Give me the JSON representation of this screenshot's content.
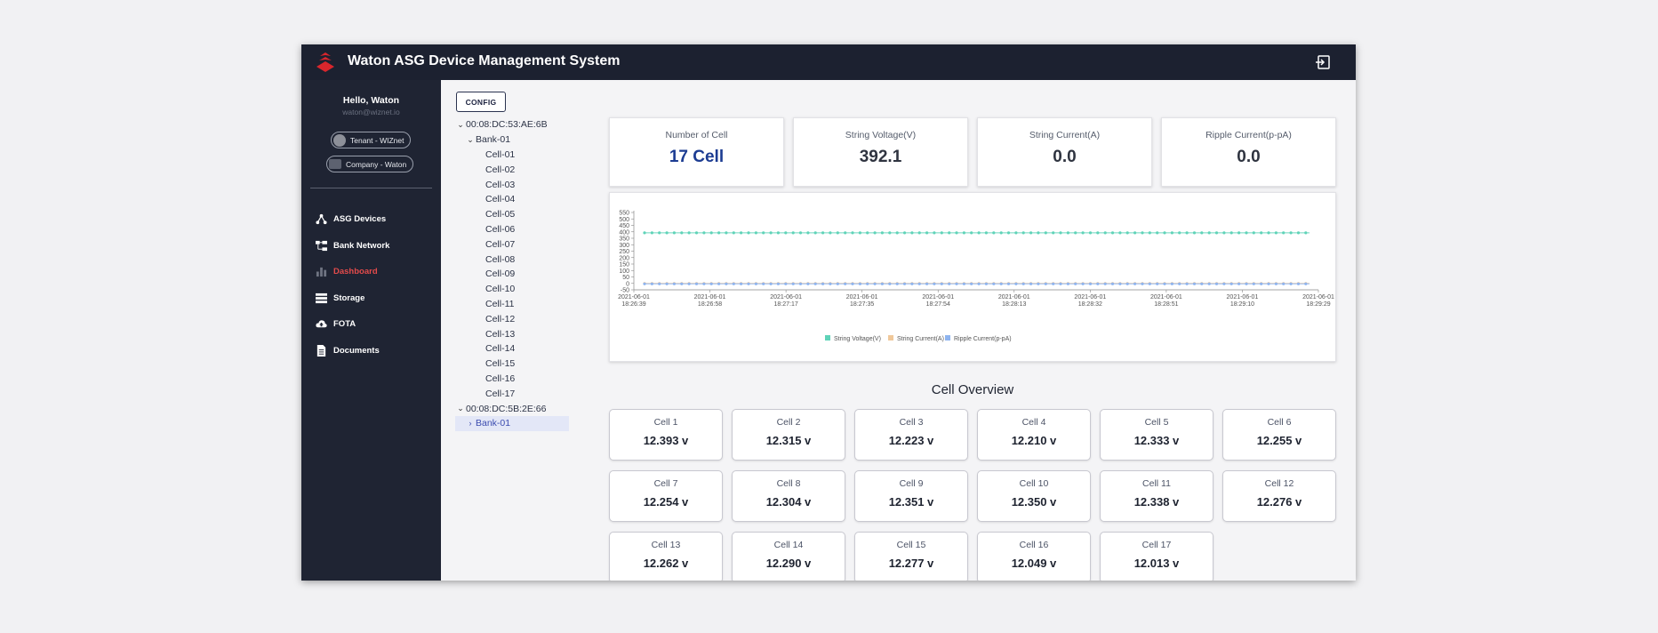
{
  "app": {
    "title": "Waton ASG Device Management System"
  },
  "colors": {
    "topbar": "#1c2130",
    "sidebar": "#1f2433",
    "active": "#e34b4b",
    "accent_blue": "#1c3c92",
    "voltage": "#5fd3b8",
    "current": "#f0c89a",
    "ripple": "#8eb4ef"
  },
  "user": {
    "hello": "Hello, Waton",
    "email": "waton@wiznet.io",
    "tenant": "Tenant - WIZnet",
    "company": "Company - Waton"
  },
  "menu": [
    {
      "label": "ASG Devices",
      "icon": "network-icon"
    },
    {
      "label": "Bank Network",
      "icon": "hierarchy-icon"
    },
    {
      "label": "Dashboard",
      "icon": "bar-chart-icon",
      "active": true
    },
    {
      "label": "Storage",
      "icon": "list-icon"
    },
    {
      "label": "FOTA",
      "icon": "cloud-upload-icon"
    },
    {
      "label": "Documents",
      "icon": "document-icon"
    }
  ],
  "config_label": "CONFIG",
  "tree": {
    "device1": "00:08:DC:53:AE:6B",
    "bank1": "Bank-01",
    "cells": [
      "Cell-01",
      "Cell-02",
      "Cell-03",
      "Cell-04",
      "Cell-05",
      "Cell-06",
      "Cell-07",
      "Cell-08",
      "Cell-09",
      "Cell-10",
      "Cell-11",
      "Cell-12",
      "Cell-13",
      "Cell-14",
      "Cell-15",
      "Cell-16",
      "Cell-17"
    ],
    "device2": "00:08:DC:5B:2E:66",
    "bank2": "Bank-01"
  },
  "stats": [
    {
      "label": "Number of Cell",
      "value": "17 Cell"
    },
    {
      "label": "String Voltage(V)",
      "value": "392.1"
    },
    {
      "label": "String Current(A)",
      "value": "0.0"
    },
    {
      "label": "Ripple Current(p-pA)",
      "value": "0.0"
    }
  ],
  "chart_data": {
    "type": "line",
    "x_ticks": [
      [
        "2021-06-01",
        "18:26:39"
      ],
      [
        "2021-06-01",
        "18:26:58"
      ],
      [
        "2021-06-01",
        "18:27:17"
      ],
      [
        "2021-06-01",
        "18:27:35"
      ],
      [
        "2021-06-01",
        "18:27:54"
      ],
      [
        "2021-06-01",
        "18:28:13"
      ],
      [
        "2021-06-01",
        "18:28:32"
      ],
      [
        "2021-06-01",
        "18:28:51"
      ],
      [
        "2021-06-01",
        "18:29:10"
      ],
      [
        "2021-06-01",
        "18:29:29"
      ]
    ],
    "ylim": [
      -50,
      550
    ],
    "y_ticks": [
      550,
      500,
      450,
      400,
      350,
      300,
      250,
      200,
      150,
      100,
      50,
      0,
      -50
    ],
    "point_count": 180,
    "series": [
      {
        "name": "String Voltage(V)",
        "value": 392.1,
        "color": "#5fd3b8"
      },
      {
        "name": "String Current(A)",
        "value": 0,
        "color": "#f0c89a"
      },
      {
        "name": "Ripple Current(p-pA)",
        "value": 0,
        "color": "#8eb4ef"
      }
    ],
    "legend_position": "bottom"
  },
  "cell_overview": {
    "title": "Cell Overview",
    "cells": [
      {
        "name": "Cell 1",
        "value": "12.393 v"
      },
      {
        "name": "Cell 2",
        "value": "12.315 v"
      },
      {
        "name": "Cell 3",
        "value": "12.223 v"
      },
      {
        "name": "Cell 4",
        "value": "12.210 v"
      },
      {
        "name": "Cell 5",
        "value": "12.333 v"
      },
      {
        "name": "Cell 6",
        "value": "12.255 v"
      },
      {
        "name": "Cell 7",
        "value": "12.254 v"
      },
      {
        "name": "Cell 8",
        "value": "12.304 v"
      },
      {
        "name": "Cell 9",
        "value": "12.351 v"
      },
      {
        "name": "Cell 10",
        "value": "12.350 v"
      },
      {
        "name": "Cell 11",
        "value": "12.338 v"
      },
      {
        "name": "Cell 12",
        "value": "12.276 v"
      },
      {
        "name": "Cell 13",
        "value": "12.262 v"
      },
      {
        "name": "Cell 14",
        "value": "12.290 v"
      },
      {
        "name": "Cell 15",
        "value": "12.277 v"
      },
      {
        "name": "Cell 16",
        "value": "12.049 v"
      },
      {
        "name": "Cell 17",
        "value": "12.013 v"
      }
    ]
  }
}
